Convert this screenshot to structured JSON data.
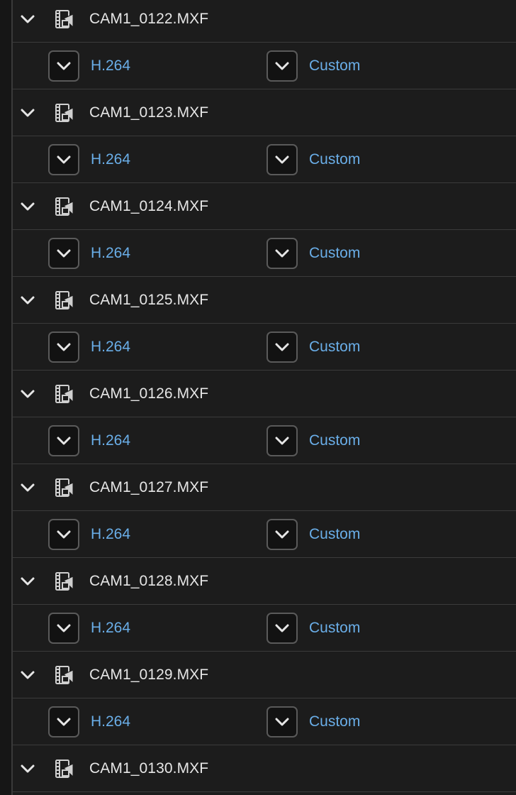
{
  "queue": {
    "items": [
      {
        "source": "CAM1_0122.MXF",
        "format": "H.264",
        "preset": "Custom"
      },
      {
        "source": "CAM1_0123.MXF",
        "format": "H.264",
        "preset": "Custom"
      },
      {
        "source": "CAM1_0124.MXF",
        "format": "H.264",
        "preset": "Custom"
      },
      {
        "source": "CAM1_0125.MXF",
        "format": "H.264",
        "preset": "Custom"
      },
      {
        "source": "CAM1_0126.MXF",
        "format": "H.264",
        "preset": "Custom"
      },
      {
        "source": "CAM1_0127.MXF",
        "format": "H.264",
        "preset": "Custom"
      },
      {
        "source": "CAM1_0128.MXF",
        "format": "H.264",
        "preset": "Custom"
      },
      {
        "source": "CAM1_0129.MXF",
        "format": "H.264",
        "preset": "Custom"
      },
      {
        "source": "CAM1_0130.MXF",
        "format": "",
        "preset": ""
      }
    ]
  },
  "icons": {
    "disclosure": "chevron-down-icon",
    "source": "video-clip-icon",
    "dropdown": "chevron-down-icon"
  },
  "colors": {
    "background": "#1c1c1c",
    "divider": "#3b3b3b",
    "text": "#e6e6e6",
    "accent": "#6aaee8"
  }
}
